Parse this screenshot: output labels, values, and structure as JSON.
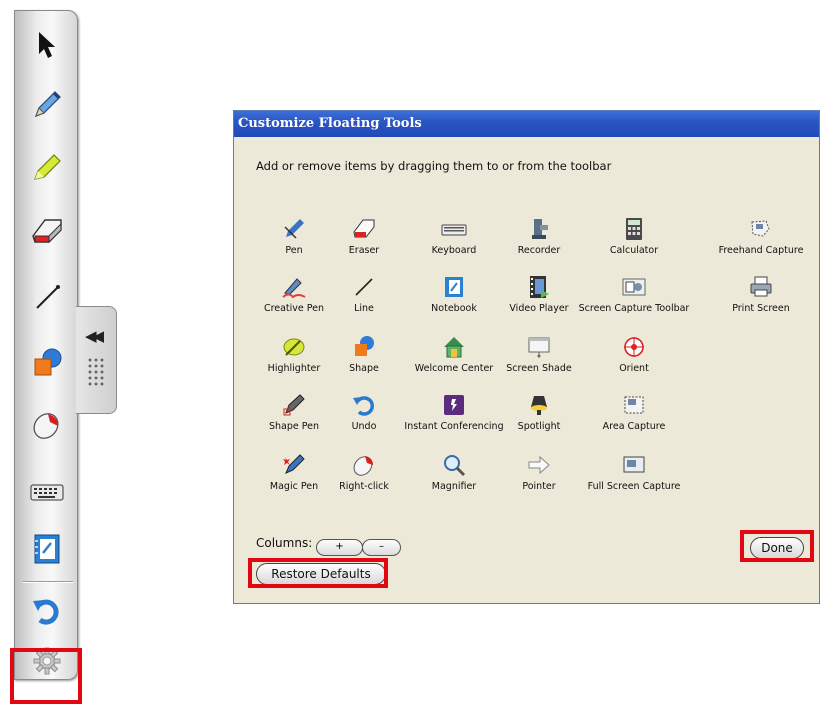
{
  "toolbar": {
    "buttons": [
      {
        "icon": "select-arrow-icon"
      },
      {
        "icon": "pen-icon"
      },
      {
        "icon": "highlighter-icon"
      },
      {
        "icon": "eraser-icon"
      },
      {
        "icon": "line-icon"
      },
      {
        "icon": "shape-icon"
      },
      {
        "icon": "right-click-icon"
      },
      {
        "icon": "keyboard-icon"
      },
      {
        "icon": "notebook-icon"
      },
      {
        "icon": "undo-icon"
      },
      {
        "icon": "gear-icon"
      }
    ],
    "handle_arrows": "◀◀"
  },
  "dialog": {
    "title": "Customize Floating Tools",
    "instructions": "Add or remove items by dragging them to or from the toolbar",
    "rows": [
      [
        "Pen",
        "Eraser",
        "Keyboard",
        "Recorder",
        "Calculator",
        "Freehand Capture"
      ],
      [
        "Creative Pen",
        "Line",
        "Notebook",
        "Video Player",
        "Screen Capture Toolbar",
        "Print Screen"
      ],
      [
        "Highlighter",
        "Shape",
        "Welcome Center",
        "Screen Shade",
        "Orient"
      ],
      [
        "Shape Pen",
        "Undo",
        "Instant Conferencing",
        "Spotlight",
        "Area Capture"
      ],
      [
        "Magic Pen",
        "Right-click",
        "Magnifier",
        "Pointer",
        "Full Screen Capture"
      ]
    ],
    "columns_label": "Columns:",
    "plus_label": "+",
    "minus_label": "–",
    "restore_label": "Restore Defaults",
    "done_label": "Done"
  },
  "colors": {
    "highlight_box": "#e30613",
    "dialog_bg": "#ece9d8",
    "titlebar": "#2a56c4"
  }
}
